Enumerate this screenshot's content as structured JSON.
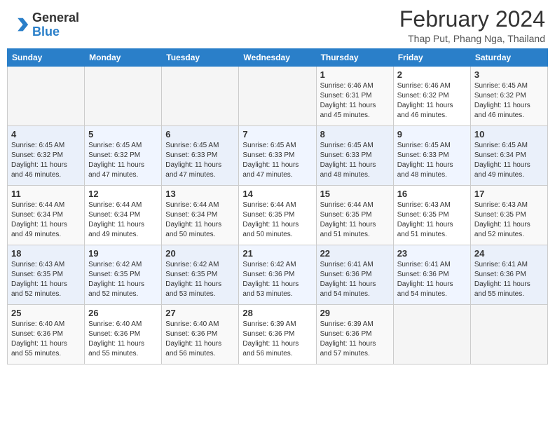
{
  "header": {
    "logo_general": "General",
    "logo_blue": "Blue",
    "main_title": "February 2024",
    "subtitle": "Thap Put, Phang Nga, Thailand"
  },
  "calendar": {
    "days_of_week": [
      "Sunday",
      "Monday",
      "Tuesday",
      "Wednesday",
      "Thursday",
      "Friday",
      "Saturday"
    ],
    "weeks": [
      [
        {
          "day": "",
          "sunrise": "",
          "sunset": "",
          "daylight": ""
        },
        {
          "day": "",
          "sunrise": "",
          "sunset": "",
          "daylight": ""
        },
        {
          "day": "",
          "sunrise": "",
          "sunset": "",
          "daylight": ""
        },
        {
          "day": "",
          "sunrise": "",
          "sunset": "",
          "daylight": ""
        },
        {
          "day": "1",
          "sunrise": "Sunrise: 6:46 AM",
          "sunset": "Sunset: 6:31 PM",
          "daylight": "Daylight: 11 hours and 45 minutes."
        },
        {
          "day": "2",
          "sunrise": "Sunrise: 6:46 AM",
          "sunset": "Sunset: 6:32 PM",
          "daylight": "Daylight: 11 hours and 46 minutes."
        },
        {
          "day": "3",
          "sunrise": "Sunrise: 6:45 AM",
          "sunset": "Sunset: 6:32 PM",
          "daylight": "Daylight: 11 hours and 46 minutes."
        }
      ],
      [
        {
          "day": "4",
          "sunrise": "Sunrise: 6:45 AM",
          "sunset": "Sunset: 6:32 PM",
          "daylight": "Daylight: 11 hours and 46 minutes."
        },
        {
          "day": "5",
          "sunrise": "Sunrise: 6:45 AM",
          "sunset": "Sunset: 6:32 PM",
          "daylight": "Daylight: 11 hours and 47 minutes."
        },
        {
          "day": "6",
          "sunrise": "Sunrise: 6:45 AM",
          "sunset": "Sunset: 6:33 PM",
          "daylight": "Daylight: 11 hours and 47 minutes."
        },
        {
          "day": "7",
          "sunrise": "Sunrise: 6:45 AM",
          "sunset": "Sunset: 6:33 PM",
          "daylight": "Daylight: 11 hours and 47 minutes."
        },
        {
          "day": "8",
          "sunrise": "Sunrise: 6:45 AM",
          "sunset": "Sunset: 6:33 PM",
          "daylight": "Daylight: 11 hours and 48 minutes."
        },
        {
          "day": "9",
          "sunrise": "Sunrise: 6:45 AM",
          "sunset": "Sunset: 6:33 PM",
          "daylight": "Daylight: 11 hours and 48 minutes."
        },
        {
          "day": "10",
          "sunrise": "Sunrise: 6:45 AM",
          "sunset": "Sunset: 6:34 PM",
          "daylight": "Daylight: 11 hours and 49 minutes."
        }
      ],
      [
        {
          "day": "11",
          "sunrise": "Sunrise: 6:44 AM",
          "sunset": "Sunset: 6:34 PM",
          "daylight": "Daylight: 11 hours and 49 minutes."
        },
        {
          "day": "12",
          "sunrise": "Sunrise: 6:44 AM",
          "sunset": "Sunset: 6:34 PM",
          "daylight": "Daylight: 11 hours and 49 minutes."
        },
        {
          "day": "13",
          "sunrise": "Sunrise: 6:44 AM",
          "sunset": "Sunset: 6:34 PM",
          "daylight": "Daylight: 11 hours and 50 minutes."
        },
        {
          "day": "14",
          "sunrise": "Sunrise: 6:44 AM",
          "sunset": "Sunset: 6:35 PM",
          "daylight": "Daylight: 11 hours and 50 minutes."
        },
        {
          "day": "15",
          "sunrise": "Sunrise: 6:44 AM",
          "sunset": "Sunset: 6:35 PM",
          "daylight": "Daylight: 11 hours and 51 minutes."
        },
        {
          "day": "16",
          "sunrise": "Sunrise: 6:43 AM",
          "sunset": "Sunset: 6:35 PM",
          "daylight": "Daylight: 11 hours and 51 minutes."
        },
        {
          "day": "17",
          "sunrise": "Sunrise: 6:43 AM",
          "sunset": "Sunset: 6:35 PM",
          "daylight": "Daylight: 11 hours and 52 minutes."
        }
      ],
      [
        {
          "day": "18",
          "sunrise": "Sunrise: 6:43 AM",
          "sunset": "Sunset: 6:35 PM",
          "daylight": "Daylight: 11 hours and 52 minutes."
        },
        {
          "day": "19",
          "sunrise": "Sunrise: 6:42 AM",
          "sunset": "Sunset: 6:35 PM",
          "daylight": "Daylight: 11 hours and 52 minutes."
        },
        {
          "day": "20",
          "sunrise": "Sunrise: 6:42 AM",
          "sunset": "Sunset: 6:35 PM",
          "daylight": "Daylight: 11 hours and 53 minutes."
        },
        {
          "day": "21",
          "sunrise": "Sunrise: 6:42 AM",
          "sunset": "Sunset: 6:36 PM",
          "daylight": "Daylight: 11 hours and 53 minutes."
        },
        {
          "day": "22",
          "sunrise": "Sunrise: 6:41 AM",
          "sunset": "Sunset: 6:36 PM",
          "daylight": "Daylight: 11 hours and 54 minutes."
        },
        {
          "day": "23",
          "sunrise": "Sunrise: 6:41 AM",
          "sunset": "Sunset: 6:36 PM",
          "daylight": "Daylight: 11 hours and 54 minutes."
        },
        {
          "day": "24",
          "sunrise": "Sunrise: 6:41 AM",
          "sunset": "Sunset: 6:36 PM",
          "daylight": "Daylight: 11 hours and 55 minutes."
        }
      ],
      [
        {
          "day": "25",
          "sunrise": "Sunrise: 6:40 AM",
          "sunset": "Sunset: 6:36 PM",
          "daylight": "Daylight: 11 hours and 55 minutes."
        },
        {
          "day": "26",
          "sunrise": "Sunrise: 6:40 AM",
          "sunset": "Sunset: 6:36 PM",
          "daylight": "Daylight: 11 hours and 55 minutes."
        },
        {
          "day": "27",
          "sunrise": "Sunrise: 6:40 AM",
          "sunset": "Sunset: 6:36 PM",
          "daylight": "Daylight: 11 hours and 56 minutes."
        },
        {
          "day": "28",
          "sunrise": "Sunrise: 6:39 AM",
          "sunset": "Sunset: 6:36 PM",
          "daylight": "Daylight: 11 hours and 56 minutes."
        },
        {
          "day": "29",
          "sunrise": "Sunrise: 6:39 AM",
          "sunset": "Sunset: 6:36 PM",
          "daylight": "Daylight: 11 hours and 57 minutes."
        },
        {
          "day": "",
          "sunrise": "",
          "sunset": "",
          "daylight": ""
        },
        {
          "day": "",
          "sunrise": "",
          "sunset": "",
          "daylight": ""
        }
      ]
    ]
  }
}
